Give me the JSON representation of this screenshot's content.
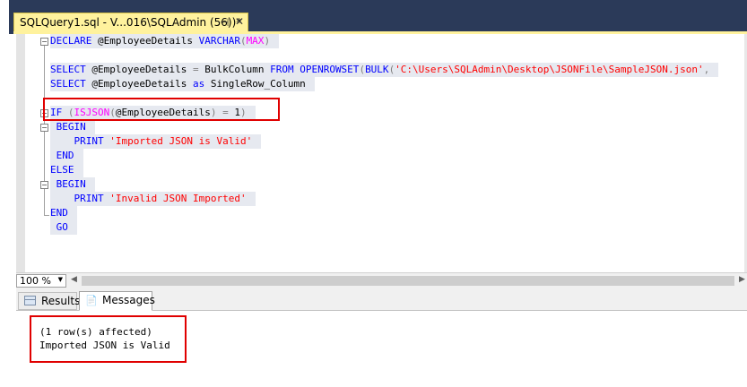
{
  "document_tab": {
    "title": "SQLQuery1.sql - V...016\\SQLAdmin (56))*",
    "pin_icon": "pin-icon",
    "close_icon": "close-icon"
  },
  "code": {
    "line1": {
      "kw1": "DECLARE",
      "var": " @EmployeeDetails ",
      "kw2": "VARCHAR",
      "p1": "(",
      "fn": "MAX",
      "p2": ")"
    },
    "line3": {
      "kw1": "SELECT",
      "t1": " @EmployeeDetails ",
      "gr1": "=",
      "t2": " BulkColumn ",
      "kw2": "FROM",
      "t3": " ",
      "kw3": "OPENROWSET",
      "gr2": "(",
      "kw4": "BULK",
      "str": "'C:\\Users\\SQLAdmin\\Desktop\\JSONFile\\SampleJSON.json'",
      "gr3": ","
    },
    "line4": {
      "kw1": "SELECT",
      "t1": " @EmployeeDetails ",
      "kw2": "as",
      "t2": " SingleRow_Column"
    },
    "line6": {
      "kw1": "IF",
      "t0": " ",
      "gr1": "(",
      "fn": "ISJSON",
      "gr2": "(",
      "var": "@EmployeeDetails",
      "gr3": ")",
      "t1": " ",
      "gr4": "=",
      "t2": " 1",
      "gr5": ")"
    },
    "line7": {
      "kw": "BEGIN"
    },
    "line8": {
      "kw": "PRINT",
      "str": "'Imported JSON is Valid'"
    },
    "line9": {
      "kw": "END"
    },
    "line10": {
      "kw": "ELSE"
    },
    "line11": {
      "kw": "BEGIN"
    },
    "line12": {
      "kw": "PRINT",
      "str": "'Invalid JSON Imported'"
    },
    "line13": {
      "kw": "END"
    },
    "line14": {
      "kw": "GO"
    }
  },
  "status_bar": {
    "zoom": "100 %"
  },
  "results": {
    "tabs": {
      "results_label": "Results",
      "messages_label": "Messages"
    },
    "messages": [
      "(1 row(s) affected)",
      "Imported JSON is Valid"
    ]
  },
  "colors": {
    "accent_tab": "#fff29d",
    "highlight_box": "#e00000",
    "keyword": "#0000ff",
    "string": "#ff0000",
    "function": "#ff00ff"
  }
}
